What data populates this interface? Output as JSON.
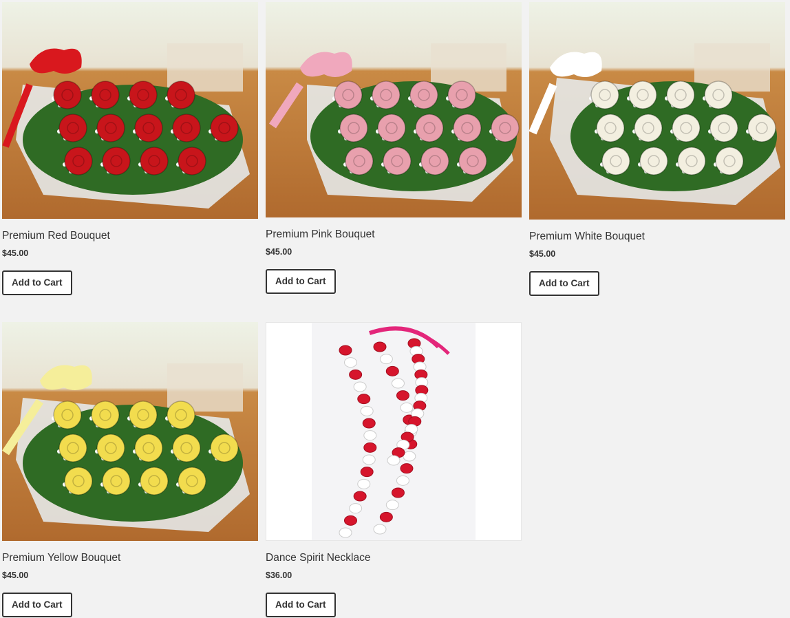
{
  "products": [
    {
      "name": "Premium Red Bouquet",
      "price": "$45.00",
      "button": "Add to Cart",
      "flower_color": "#c8151b",
      "ribbon_color": "#d9181e"
    },
    {
      "name": "Premium Pink Bouquet",
      "price": "$45.00",
      "button": "Add to Cart",
      "flower_color": "#e8a0ad",
      "ribbon_color": "#f0a8bd"
    },
    {
      "name": "Premium White Bouquet",
      "price": "$45.00",
      "button": "Add to Cart",
      "flower_color": "#f3efe0",
      "ribbon_color": "#ffffff"
    },
    {
      "name": "Premium Yellow Bouquet",
      "price": "$45.00",
      "button": "Add to Cart",
      "flower_color": "#f2dc4e",
      "ribbon_color": "#f5ee9a"
    },
    {
      "name": "Dance Spirit Necklace",
      "price": "$36.00",
      "button": "Add to Cart",
      "bead_color": "#d6152c",
      "accent_color": "#e3267a"
    }
  ]
}
